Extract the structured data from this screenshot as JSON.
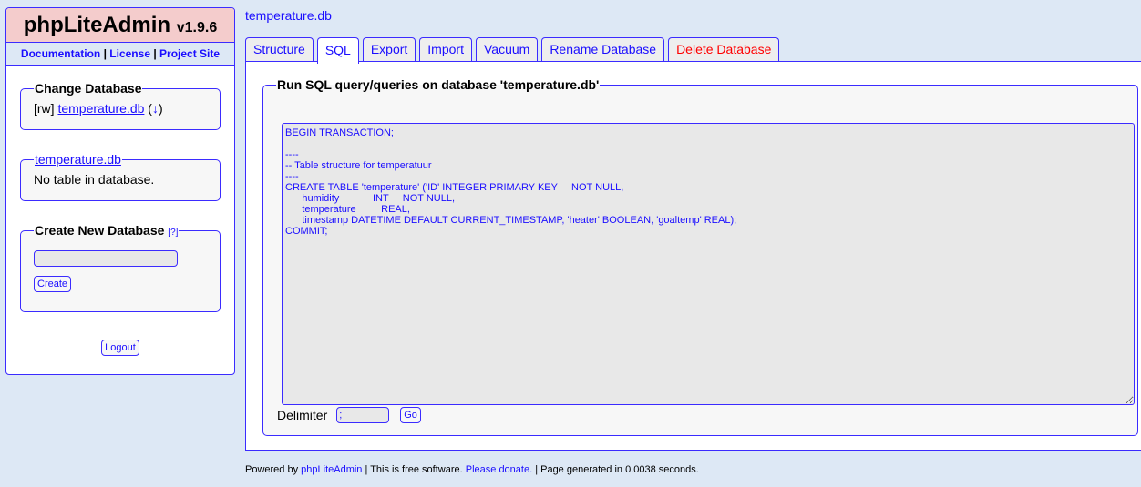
{
  "sidebar": {
    "app_name": "phpLiteAdmin",
    "version": "v1.9.6",
    "links": [
      "Documentation",
      "License",
      "Project Site"
    ],
    "change_db": {
      "legend": "Change Database",
      "mode": "[rw]",
      "db": "temperature.db",
      "download": "↓"
    },
    "db_box": {
      "legend": "temperature.db",
      "text": "No table in database."
    },
    "create_db": {
      "legend": "Create New Database",
      "help": "[?]",
      "input_value": "",
      "button": "Create"
    },
    "logout": "Logout"
  },
  "main": {
    "title": "temperature.db",
    "tabs": [
      {
        "label": "Structure"
      },
      {
        "label": "SQL"
      },
      {
        "label": "Export"
      },
      {
        "label": "Import"
      },
      {
        "label": "Vacuum"
      },
      {
        "label": "Rename Database"
      },
      {
        "label": "Delete Database"
      }
    ],
    "sql_legend": "Run SQL query/queries on database 'temperature.db'",
    "query": "BEGIN TRANSACTION;\n\n----\n-- Table structure for temperatuur\n----\nCREATE TABLE 'temperature' ('ID' INTEGER PRIMARY KEY     NOT NULL,\n      humidity            INT     NOT NULL,\n      temperature         REAL,\n      timestamp DATETIME DEFAULT CURRENT_TIMESTAMP, 'heater' BOOLEAN, 'goaltemp' REAL);\nCOMMIT;",
    "delimiter_label": "Delimiter",
    "delimiter_value": ";",
    "go": "Go"
  },
  "footer": {
    "powered": "Powered by",
    "link1": "phpLiteAdmin",
    "sep1": " | This is free software. ",
    "link2": "Please donate.",
    "rest": " | Page generated in 0.0038 seconds."
  },
  "colors": {
    "link": "#1a0dff",
    "danger": "#ff0000",
    "header": "#f4cccc"
  }
}
